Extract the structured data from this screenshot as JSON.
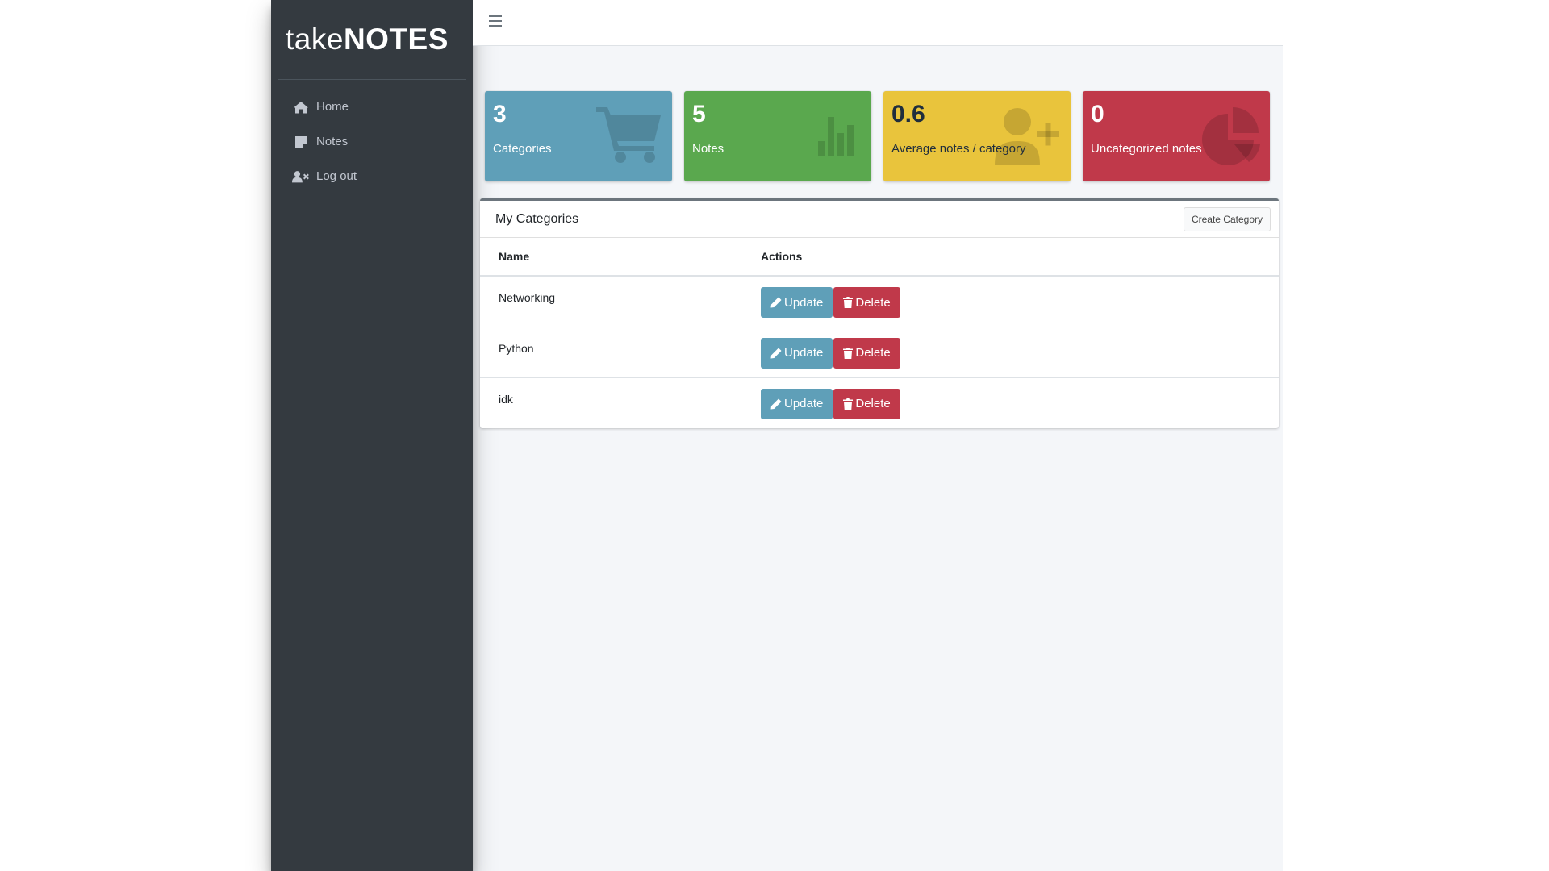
{
  "brand": {
    "light": "take",
    "bold": "NOTES"
  },
  "sidebar": {
    "items": [
      {
        "label": "Home",
        "icon": "home-icon"
      },
      {
        "label": "Notes",
        "icon": "sticky-note-icon"
      },
      {
        "label": "Log out",
        "icon": "user-times-icon"
      }
    ]
  },
  "stats": [
    {
      "value": "3",
      "label": "Categories",
      "color": "#5f9fb8",
      "icon": "shopping-cart-icon"
    },
    {
      "value": "5",
      "label": "Notes",
      "color": "#5aa84e",
      "icon": "bar-chart-icon"
    },
    {
      "value": "0.6",
      "label": "Average notes / category",
      "color": "#e9c43c",
      "icon": "user-plus-icon"
    },
    {
      "value": "0",
      "label": "Uncategorized notes",
      "color": "#c0394a",
      "icon": "pie-chart-icon"
    }
  ],
  "card": {
    "title": "My Categories",
    "create_label": "Create Category",
    "columns": [
      "Name",
      "Actions"
    ],
    "rows": [
      {
        "name": "Networking"
      },
      {
        "name": "Python"
      },
      {
        "name": "idk"
      }
    ],
    "update_label": "Update",
    "delete_label": "Delete"
  }
}
